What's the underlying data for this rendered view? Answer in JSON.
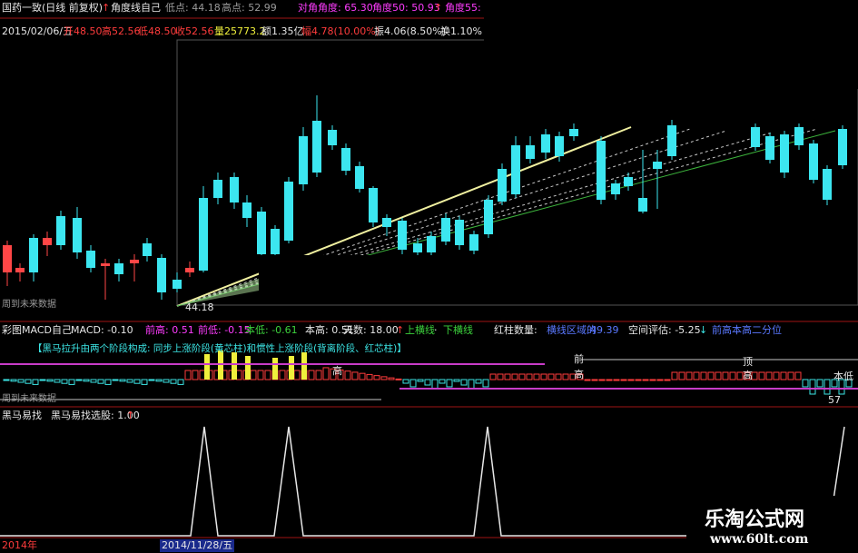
{
  "header": {
    "stock_title": "国药一致(日线 前复权)",
    "indicator_name": "角度线自己",
    "low_label": "低点: 44.18",
    "high_label": "高点: 52.99",
    "diag_angle": "对角角度: 65.30",
    "angle50": "角度50: 50.93",
    "angle55": "角度55:"
  },
  "quote_bar": {
    "date": "2015/02/06/五",
    "open": "开48.50",
    "high": "高52.56",
    "low": "低48.50",
    "close": "收52.56",
    "volume": "量25773.2",
    "amount": "额1.35亿",
    "change": "幅4.78(10.00%)",
    "amplitude": "振4.06(8.50%)",
    "turnover": "换1.10%"
  },
  "main_panel": {
    "low_marker": "44.18",
    "future_hint": "周到未来数据"
  },
  "macd_panel": {
    "name": "彩图MACD自己",
    "macd": "MACD: -0.10",
    "prev_high": "前高: 0.51",
    "prev_low": "前低: -0.15",
    "this_low": "本低: -0.61",
    "this_high": "本高: 0.51",
    "days": "天数: 18.00",
    "up_break": "上横线",
    "down_break": "下横线",
    "red_count": "红柱数量:",
    "blue_text": "横线区域的",
    "blue_value": "49.39",
    "space_eval": "空间评估: -5.25",
    "prev_high_2": "前高本高二分位",
    "note": "【黑马拉升由两个阶段构成: 同步上涨阶段(黄芯柱)和惯性上涨阶段(背离阶段、红芯柱)】",
    "label_high": "高",
    "label_prev": "前",
    "label_prev_high": "高",
    "label_top": "顶",
    "label_top_high": "高",
    "label_57": "57",
    "label_fu": "本低",
    "future_hint": "周到未来数据"
  },
  "horse_panel": {
    "name": "黑马易找",
    "select": "黑马易找选股: 1.00"
  },
  "date_axis": {
    "year": "2014年",
    "date": "2014/11/28/五"
  },
  "watermark": {
    "title": "乐淘公式网",
    "url": "www.60lt.com"
  }
}
